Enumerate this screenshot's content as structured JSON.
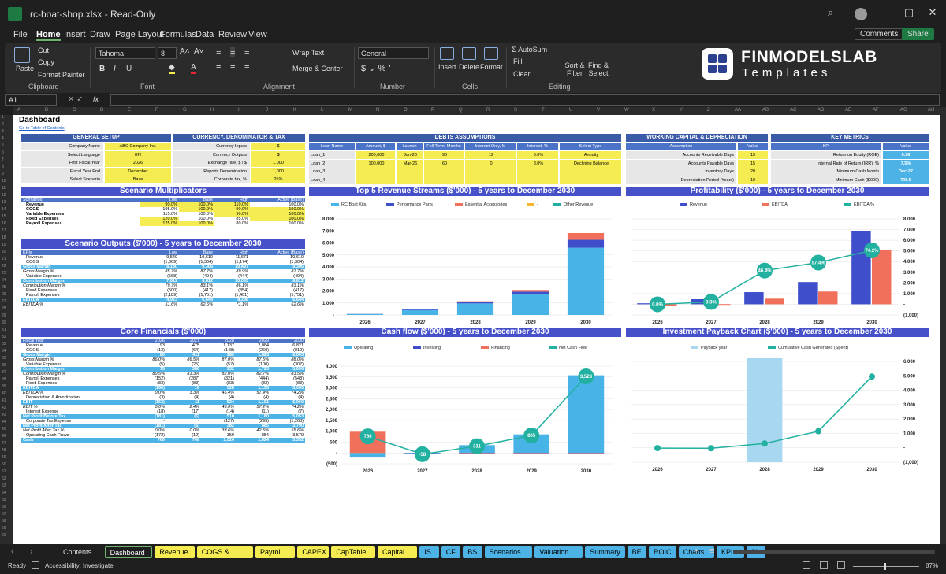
{
  "window": {
    "filename": "rc-boat-shop.xlsx  -  Read-Only",
    "min": "—",
    "max": "▢",
    "close": "✕"
  },
  "menu": [
    "File",
    "Home",
    "Insert",
    "Draw",
    "Page Layout",
    "Formulas",
    "Data",
    "Review",
    "View"
  ],
  "top_buttons": {
    "comments": "Comments",
    "share": "Share"
  },
  "ribbon": {
    "paste": "Paste",
    "cut": "Cut",
    "copy": "Copy",
    "format_painter": "Format Painter",
    "clipboard": "Clipboard",
    "font_name": "Tahoma",
    "font_size": "8",
    "font": "Font",
    "wrap": "Wrap Text",
    "merge": "Merge & Center",
    "alignment": "Alignment",
    "number_format": "General",
    "number": "Number",
    "insert": "Insert",
    "delete": "Delete",
    "format": "Format",
    "cells": "Cells",
    "autosum": "AutoSum",
    "fill": "Fill",
    "clear": "Clear",
    "sort": "Sort & Filter",
    "find": "Find & Select",
    "editing": "Editing"
  },
  "logo": {
    "line1": "FINMODELSLAB",
    "line2": "Templates"
  },
  "formula": {
    "cell": "A1",
    "fx": "fx"
  },
  "columns": [
    "A",
    "B",
    "C",
    "D",
    "E",
    "F",
    "G",
    "H",
    "I",
    "J",
    "K",
    "L",
    "M",
    "N",
    "O",
    "P",
    "Q",
    "R",
    "S",
    "T",
    "U",
    "V",
    "W",
    "X",
    "Y",
    "Z",
    "AA",
    "AB",
    "AC",
    "AD",
    "AE",
    "AF",
    "AG",
    "AH"
  ],
  "sheet": {
    "title": "Dashboard",
    "toc_link": "Go to Table of Contents",
    "general_setup": {
      "title": "GENERAL SETUP",
      "rows": [
        [
          "Company Name",
          "ABC Company Inc."
        ],
        [
          "Select Language",
          "EN"
        ],
        [
          "First Fiscal Year",
          "2026"
        ],
        [
          "Fiscal Year End",
          "December"
        ],
        [
          "Select Scenario",
          "Base"
        ]
      ]
    },
    "currency": {
      "title": "CURRENCY, DENOMINATOR & TAX",
      "rows": [
        [
          "Currency Inputs",
          "$"
        ],
        [
          "Currency Outputs",
          "$"
        ],
        [
          "Exchange rate, $ / $",
          "1.000"
        ],
        [
          "Reports Denomination",
          "1,000"
        ],
        [
          "Corporate tax, %",
          "25%"
        ]
      ]
    },
    "debts": {
      "title": "DEBTS ASSUMPTIONS",
      "headers": [
        "Loan Name",
        "Amount, $",
        "Launch",
        "Full Term, Months",
        "Interest-Only, M",
        "Interest, %",
        "Select Type"
      ],
      "rows": [
        [
          "Loan_1",
          "200,000",
          "Jan-26",
          "90",
          "12",
          "6.0%",
          "Annuity"
        ],
        [
          "Loan_2",
          "100,000",
          "Mar-26",
          "60",
          "0",
          "8.0%",
          "Declining Balance"
        ],
        [
          "Loan_3",
          "",
          "",
          "",
          "",
          "",
          ""
        ],
        [
          "Loan_4",
          "",
          "",
          "",
          "",
          "",
          ""
        ]
      ]
    },
    "working_capital": {
      "title": "WORKING CAPITAL & DEPRECIATION",
      "headers": [
        "Assumption",
        "Value"
      ],
      "rows": [
        [
          "Accounts Receivable Days",
          "15"
        ],
        [
          "Accounts Payable Days",
          "15"
        ],
        [
          "Inventory Days",
          "20"
        ],
        [
          "Depreciation Period (Years)",
          "10"
        ]
      ]
    },
    "key_metrics": {
      "title": "KEY METRICS",
      "headers": [
        "KPI",
        "Value"
      ],
      "rows": [
        [
          "Return on Equity (ROE)",
          "6.96"
        ],
        [
          "Internal Rate of Return (IRR), %",
          "7.5%"
        ],
        [
          "Minimum Cash Month",
          "Dec-27"
        ],
        [
          "Minimum Cash ($'000)",
          "708.5"
        ]
      ]
    },
    "scenario_mult": {
      "title": "Scenario Multiplicators",
      "headers": [
        "Scenarios",
        "Low",
        "Base",
        "High",
        "Active (Base)"
      ],
      "rows": [
        [
          "Revenue",
          "90.0%",
          "100.0%",
          "110.0%",
          "100.0%"
        ],
        [
          "COGS",
          "105.0%",
          "100.0%",
          "90.0%",
          "100.0%"
        ],
        [
          "Variable Expenses",
          "115.0%",
          "100.0%",
          "90.0%",
          "100.0%"
        ],
        [
          "Fixed Expenses",
          "120.0%",
          "100.0%",
          "85.0%",
          "100.0%"
        ],
        [
          "Payroll Expenses",
          "125.0%",
          "100.0%",
          "80.0%",
          "100.0%"
        ]
      ]
    },
    "scenario_out": {
      "title": "Scenario Outputs ($'000) - 5 years to December 2030",
      "headers": [
        "KPIs",
        "Low",
        "Base",
        "High",
        "Active (Base)"
      ],
      "rows": [
        [
          "Revenue",
          "9,549",
          "10,610",
          "11,671",
          "10,610",
          ""
        ],
        [
          "COGS",
          "(1,369)",
          "(1,304)",
          "(1,174)",
          "(1,304)",
          ""
        ],
        [
          "Gross Margin",
          "8,180",
          "9,306",
          "10,497",
          "9,306",
          "hl"
        ],
        [
          "Gross Margin %",
          "85.7%",
          "87.7%",
          "89.9%",
          "87.7%",
          "it"
        ],
        [
          "Variable Expenses",
          "(568)",
          "(494)",
          "(444)",
          "(494)",
          ""
        ],
        [
          "Contribution Margin",
          "7,612",
          "8,812",
          "10,053",
          "8,812",
          "hl"
        ],
        [
          "Contribution Margin %",
          "79.7%",
          "83.1%",
          "86.1%",
          "83.1%",
          "it"
        ],
        [
          "Fixed Expenses",
          "(500)",
          "(417)",
          "(354)",
          "(417)",
          ""
        ],
        [
          "Payroll Expenses",
          "(2,189)",
          "(1,751)",
          "(1,401)",
          "(1,751)",
          ""
        ],
        [
          "EBITDA",
          "4,923",
          "6,644",
          "8,298",
          "6,644",
          "hl"
        ],
        [
          "EBITDA %",
          "51.6%",
          "62.6%",
          "71.1%",
          "62.6%",
          "it"
        ]
      ]
    },
    "core_fin": {
      "title": "Core Financials ($'000)",
      "headers": [
        "Fiscal Year",
        "2026",
        "2027",
        "2028",
        "2029",
        "2030"
      ],
      "rows": [
        [
          "Revenue",
          "93",
          "475",
          "1,137",
          "2,084",
          "6,821",
          ""
        ],
        [
          "COGS",
          "(13)",
          "(64)",
          "(148)",
          "(260)",
          "(819)",
          ""
        ],
        [
          "Gross Margin",
          "80",
          "411",
          "989",
          "1,823",
          "6,003",
          "hl"
        ],
        [
          "Gross Margin %",
          "86.0%",
          "86.5%",
          "87.0%",
          "87.5%",
          "88.0%",
          "it"
        ],
        [
          "Variable Expenses",
          "(5)",
          "(25)",
          "(57)",
          "(100)",
          "(307)",
          ""
        ],
        [
          "Contribution Margin",
          "75",
          "386",
          "932",
          "1,723",
          "5,696",
          "hl"
        ],
        [
          "Contribution Margin %",
          "80.5%",
          "81.3%",
          "82.0%",
          "82.7%",
          "83.5%",
          "it"
        ],
        [
          "Payroll Expenses",
          "(152)",
          "(287)",
          "(321)",
          "(444)",
          "(548)",
          ""
        ],
        [
          "Fixed Expenses",
          "(83)",
          "(83)",
          "(83)",
          "(83)",
          "(83)",
          ""
        ],
        [
          "EBITDA",
          "(160)",
          "16",
          "528",
          "1,195",
          "5,065",
          "hl"
        ],
        [
          "EBITDA %",
          "0.0%",
          "3.3%",
          "46.4%",
          "57.4%",
          "74.2%",
          "it"
        ],
        [
          "Depreciation & Amortization",
          "(3)",
          "(4)",
          "(4)",
          "(4)",
          "(4)",
          ""
        ],
        [
          "EBIT",
          "(163)",
          "11",
          "524",
          "1,191",
          "5,060",
          "hl"
        ],
        [
          "EBIT %",
          "0.0%",
          "2.4%",
          "46.0%",
          "57.2%",
          "74.2%",
          "it"
        ],
        [
          "Interest Expense",
          "(18)",
          "(17)",
          "(14)",
          "(11)",
          "(7)",
          ""
        ],
        [
          "Net Profit Before Tax",
          "(181)",
          "(6)",
          "510",
          "1,180",
          "5,053",
          "hl"
        ],
        [
          "Corporate Tax Expense",
          "-",
          "-",
          "(127)",
          "(295)",
          "(1,263)",
          ""
        ],
        [
          "Net Profit After Tax",
          "(181)",
          "(6)",
          "382",
          "885",
          "3,790",
          "hl"
        ],
        [
          "Net Profit After Tax %",
          "0.0%",
          "0.0%",
          "33.6%",
          "42.5%",
          "55.6%",
          "it"
        ],
        [
          "Operating Cash Flows",
          "(172)",
          "(12)",
          "359",
          "854",
          "3,579",
          ""
        ],
        [
          "Cash",
          "766",
          "708",
          "1,020",
          "1,824",
          "5,352",
          "hl"
        ]
      ]
    }
  },
  "chart_data": [
    {
      "type": "bar",
      "title": "Top 5 Revenue Streams ($'000) - 5 years to December 2030",
      "categories": [
        "2026",
        "2027",
        "2028",
        "2029",
        "2030"
      ],
      "ylim": [
        0,
        8000
      ],
      "yticks": [
        "-",
        "1,000",
        "2,000",
        "3,000",
        "4,000",
        "5,000",
        "6,000",
        "7,000",
        "8,000"
      ],
      "series": [
        {
          "name": "RC Boat Kits",
          "color": "#47b3e6",
          "values": [
            80,
            410,
            960,
            1700,
            5600
          ]
        },
        {
          "name": "Performance Parts",
          "color": "#3f4fcb",
          "values": [
            10,
            50,
            120,
            240,
            660
          ]
        },
        {
          "name": "Essential Accessories",
          "color": "#f0705c",
          "values": [
            3,
            15,
            57,
            144,
            561
          ]
        },
        {
          "name": "-",
          "color": "#f5b830",
          "values": [
            0,
            0,
            0,
            0,
            0
          ]
        },
        {
          "name": "Other Revenue",
          "color": "#22b0a0",
          "values": [
            0,
            0,
            0,
            0,
            0
          ]
        }
      ]
    },
    {
      "type": "bar",
      "title": "Profitability ($'000) - 5 years to December 2030",
      "categories": [
        "2026",
        "2027",
        "2028",
        "2029",
        "2030"
      ],
      "ylim": [
        -1000,
        8000
      ],
      "yticks": [
        "(1,000)",
        "-",
        "1,000",
        "2,000",
        "3,000",
        "4,000",
        "5,000",
        "6,000",
        "7,000",
        "8,000"
      ],
      "series": [
        {
          "name": "Revenue",
          "color": "#3f4fcb",
          "values": [
            93,
            475,
            1137,
            2084,
            6821
          ]
        },
        {
          "name": "EBITDA",
          "color": "#f0705c",
          "values": [
            -160,
            16,
            528,
            1195,
            5065
          ]
        },
        {
          "name": "EBITDA %",
          "color": "#22b0a0",
          "values": [
            0.0,
            3.3,
            46.4,
            57.4,
            74.2
          ],
          "labels": [
            "0.0%",
            "3.3%",
            "46.4%",
            "57.4%",
            "74.2%"
          ]
        }
      ]
    },
    {
      "type": "bar",
      "title": "Cash flow ($'000) - 5 years to December 2030",
      "categories": [
        "2026",
        "2027",
        "2028",
        "2029",
        "2030"
      ],
      "ylim": [
        -500,
        4000
      ],
      "yticks": [
        "(500)",
        "-",
        "500",
        "1,000",
        "1,500",
        "2,000",
        "2,500",
        "3,000",
        "3,500",
        "4,000"
      ],
      "series": [
        {
          "name": "Operating",
          "color": "#47b3e6",
          "values": [
            -172,
            -12,
            359,
            854,
            3579
          ]
        },
        {
          "name": "Investing",
          "color": "#3f4fcb",
          "values": [
            -40,
            -20,
            -10,
            -10,
            -10
          ]
        },
        {
          "name": "Financing",
          "color": "#f0705c",
          "values": [
            978,
            -26,
            -37,
            -40,
            -41
          ]
        },
        {
          "name": "Net Cash Flow",
          "color": "#22b0a0",
          "values": [
            766,
            -58,
            311,
            805,
            3528
          ],
          "labels": [
            "766",
            "-58",
            "311",
            "805",
            "3,528"
          ]
        }
      ]
    },
    {
      "type": "line",
      "title": "Investment Payback Chart ($'000) - 5 years to December 2030",
      "categories": [
        "2026",
        "2027",
        "2028",
        "2029",
        "2030"
      ],
      "ylim": [
        -1000,
        6000
      ],
      "yticks": [
        "(1,000)",
        "-",
        "1,000",
        "2,000",
        "3,000",
        "4,000",
        "5,000",
        "6,000"
      ],
      "series": [
        {
          "name": "Payback year",
          "color": "#a8d8f0",
          "values": [
            0,
            0,
            1,
            0,
            0
          ]
        },
        {
          "name": "Cumulative Cash Generated (Spent)",
          "color": "#22b0a0",
          "values": [
            -20,
            -32,
            300,
            1150,
            4950
          ]
        }
      ]
    }
  ],
  "tabs": [
    {
      "label": "Contents",
      "color": "none"
    },
    {
      "label": "Dashboard",
      "color": "active"
    },
    {
      "label": "Revenue",
      "color": "#f5ec52"
    },
    {
      "label": "COGS & OPEX",
      "color": "#f5ec52"
    },
    {
      "label": "Payroll",
      "color": "#f5ec52"
    },
    {
      "label": "CAPEX",
      "color": "#f5ec52"
    },
    {
      "label": "CapTable",
      "color": "#f5ec52"
    },
    {
      "label": "Capital",
      "color": "#f5ec52"
    },
    {
      "label": "IS",
      "color": "#4db3e6"
    },
    {
      "label": "CF",
      "color": "#4db3e6"
    },
    {
      "label": "BS",
      "color": "#4db3e6"
    },
    {
      "label": "Scenarios",
      "color": "#4db3e6"
    },
    {
      "label": "Valuation",
      "color": "#4db3e6"
    },
    {
      "label": "Summary",
      "color": "#4db3e6"
    },
    {
      "label": "BE",
      "color": "#4db3e6"
    },
    {
      "label": "ROIC",
      "color": "#4db3e6"
    },
    {
      "label": "Charts",
      "color": "#4db3e6"
    },
    {
      "label": "KPIs",
      "color": "#4db3e6"
    },
    {
      "label": "Si",
      "color": "#4db3e6"
    }
  ],
  "status": {
    "ready": "Ready",
    "accessibility": "Accessibility: Investigate",
    "zoom": "87%"
  }
}
